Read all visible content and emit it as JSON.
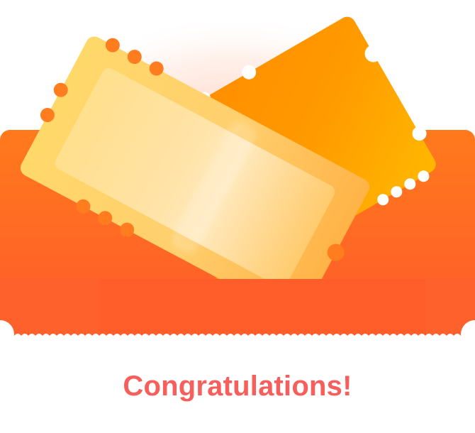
{
  "reward": {
    "title": "Congratulations!",
    "colors": {
      "title": "#f75f5c",
      "envelope": "#ff6a2a",
      "ticket_back": "#ff9200",
      "ticket_front": "#ffd57a"
    }
  }
}
